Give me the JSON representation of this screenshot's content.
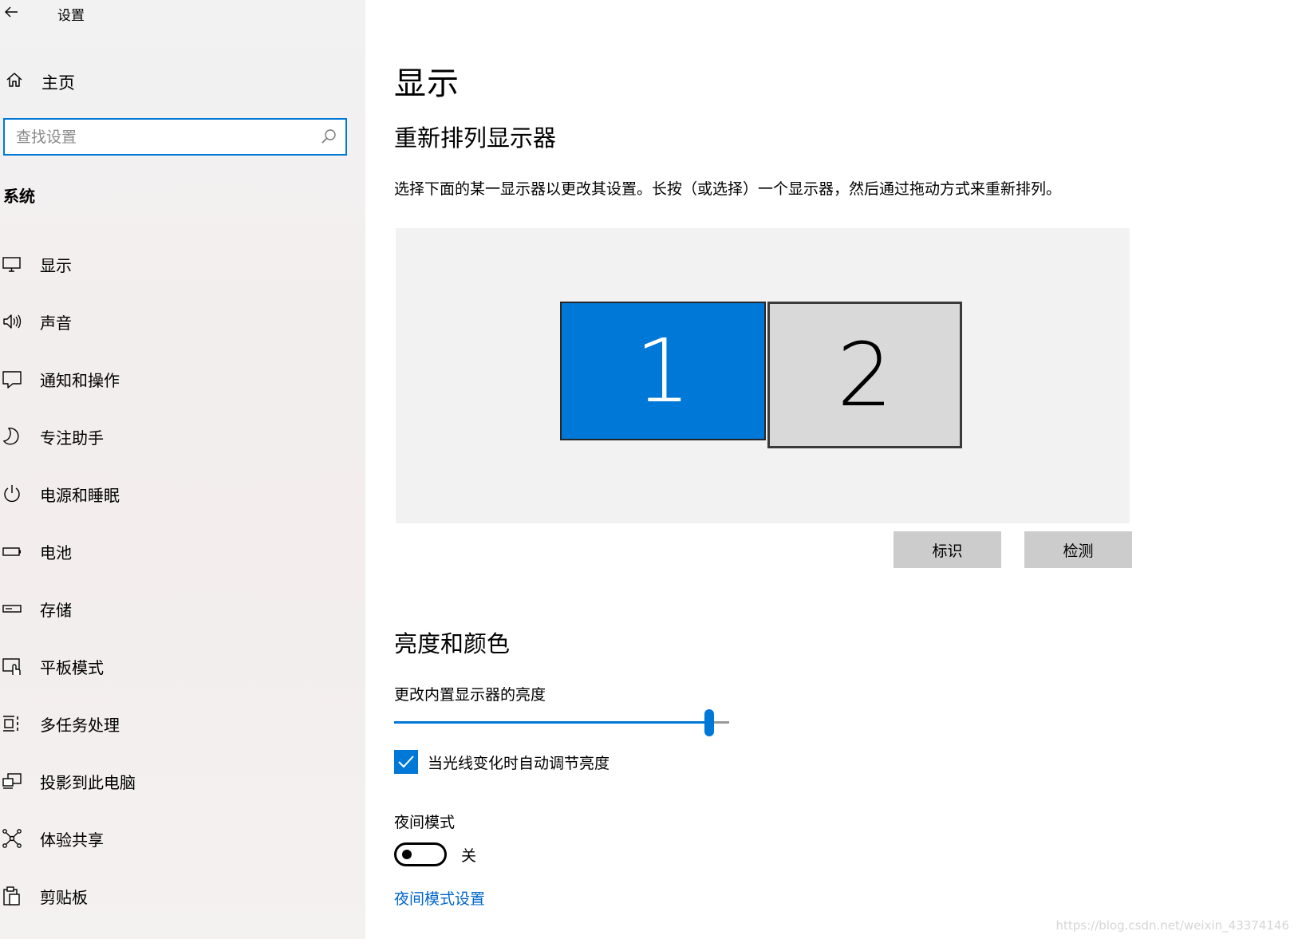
{
  "app": {
    "title": "设置"
  },
  "sidebar": {
    "home_label": "主页",
    "search": {
      "placeholder": "查找设置",
      "value": ""
    },
    "section_label": "系统",
    "items": [
      {
        "label": "显示",
        "icon": "monitor-icon"
      },
      {
        "label": "声音",
        "icon": "speaker-icon"
      },
      {
        "label": "通知和操作",
        "icon": "notification-icon"
      },
      {
        "label": "专注助手",
        "icon": "moon-icon"
      },
      {
        "label": "电源和睡眠",
        "icon": "power-icon"
      },
      {
        "label": "电池",
        "icon": "battery-icon"
      },
      {
        "label": "存储",
        "icon": "storage-icon"
      },
      {
        "label": "平板模式",
        "icon": "tablet-mode-icon"
      },
      {
        "label": "多任务处理",
        "icon": "multitasking-icon"
      },
      {
        "label": "投影到此电脑",
        "icon": "project-icon"
      },
      {
        "label": "体验共享",
        "icon": "share-icon"
      },
      {
        "label": "剪贴板",
        "icon": "clipboard-icon"
      }
    ]
  },
  "main": {
    "title": "显示",
    "arrange": {
      "heading": "重新排列显示器",
      "description": "选择下面的某一显示器以更改其设置。长按（或选择）一个显示器，然后通过拖动方式来重新排列。",
      "monitors": [
        {
          "label": "1",
          "selected": true,
          "color": "#0078d7"
        },
        {
          "label": "2",
          "selected": false,
          "color": "#d9d9d9"
        }
      ],
      "identify_label": "标识",
      "detect_label": "检测"
    },
    "brightness": {
      "heading": "亮度和颜色",
      "slider_label": "更改内置显示器的亮度",
      "level_percent": 94,
      "auto_adjust_label": "当光线变化时自动调节亮度",
      "auto_adjust_checked": true,
      "night_mode_label": "夜间模式",
      "night_mode_state": "关",
      "night_mode_on": false,
      "night_mode_settings_link": "夜间模式设置"
    }
  },
  "watermark": "https://blog.csdn.net/weixin_43374146",
  "colors": {
    "accent": "#0078d7",
    "button": "#cccccc",
    "link": "#0066cc"
  }
}
